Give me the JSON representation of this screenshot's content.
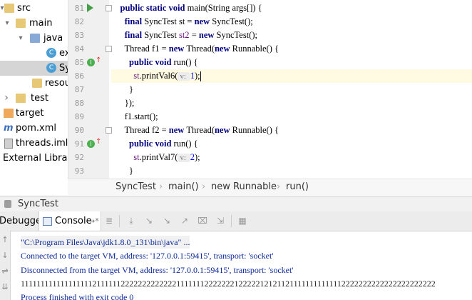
{
  "tree": {
    "items": [
      {
        "label": "src",
        "arrow": "▾",
        "icon": "folder"
      },
      {
        "label": "main",
        "arrow": "▾",
        "icon": "folder"
      },
      {
        "label": "java",
        "arrow": "▾",
        "icon": "folder-blue"
      },
      {
        "label": "ex",
        "arrow": "",
        "icon": "class"
      },
      {
        "label": "Sy",
        "arrow": "",
        "icon": "class"
      },
      {
        "label": "resou",
        "arrow": "",
        "icon": "folder"
      },
      {
        "label": "test",
        "arrow": "›",
        "icon": "folder"
      },
      {
        "label": "target",
        "arrow": "",
        "icon": "folder-orange"
      },
      {
        "label": "pom.xml",
        "arrow": "",
        "icon": "maven"
      },
      {
        "label": "threads.iml",
        "arrow": "",
        "icon": "iml"
      },
      {
        "label": "External Librarie",
        "arrow": "",
        "icon": "none"
      }
    ]
  },
  "editor": {
    "lines": [
      {
        "n": "81",
        "parts": [
          [
            "",
            "    "
          ],
          [
            "kw",
            "public static void "
          ],
          [
            "",
            "main(String args[]) {"
          ]
        ]
      },
      {
        "n": "82",
        "parts": [
          [
            "",
            "      "
          ],
          [
            "kw",
            "final "
          ],
          [
            "",
            "SyncTest st = "
          ],
          [
            "kw",
            "new "
          ],
          [
            "",
            "SyncTest();"
          ]
        ]
      },
      {
        "n": "83",
        "parts": [
          [
            "",
            "      "
          ],
          [
            "kw",
            "final "
          ],
          [
            "",
            "SyncTest "
          ],
          [
            "fld",
            "st2"
          ],
          [
            "",
            " = "
          ],
          [
            "kw",
            "new "
          ],
          [
            "",
            "SyncTest();"
          ]
        ]
      },
      {
        "n": "84",
        "parts": [
          [
            "",
            "      Thread f1 = "
          ],
          [
            "kw",
            "new "
          ],
          [
            "",
            "Thread("
          ],
          [
            "kw",
            "new "
          ],
          [
            "",
            "Runnable() {"
          ]
        ]
      },
      {
        "n": "85",
        "parts": [
          [
            "",
            "        "
          ],
          [
            "kw",
            "public void "
          ],
          [
            "",
            "run() {"
          ]
        ]
      },
      {
        "n": "86",
        "parts": [
          [
            "",
            "          "
          ],
          [
            "fld",
            "st"
          ],
          [
            "",
            ".printVal6("
          ],
          [
            "hint",
            "v: "
          ],
          [
            "num",
            "1"
          ],
          [
            "",
            ");"
          ]
        ]
      },
      {
        "n": "87",
        "parts": [
          [
            "",
            "        }"
          ]
        ]
      },
      {
        "n": "88",
        "parts": [
          [
            "",
            "      });"
          ]
        ]
      },
      {
        "n": "89",
        "parts": [
          [
            "",
            "      f1.start();"
          ]
        ]
      },
      {
        "n": "90",
        "parts": [
          [
            "",
            "      Thread f2 = "
          ],
          [
            "kw",
            "new "
          ],
          [
            "",
            "Thread("
          ],
          [
            "kw",
            "new "
          ],
          [
            "",
            "Runnable() {"
          ]
        ]
      },
      {
        "n": "91",
        "parts": [
          [
            "",
            "        "
          ],
          [
            "kw",
            "public void "
          ],
          [
            "",
            "run() {"
          ]
        ]
      },
      {
        "n": "92",
        "parts": [
          [
            "",
            "          "
          ],
          [
            "fld",
            "st"
          ],
          [
            "",
            ".printVal7("
          ],
          [
            "hint",
            "v: "
          ],
          [
            "num",
            "2"
          ],
          [
            "",
            ");"
          ]
        ]
      },
      {
        "n": "93",
        "parts": [
          [
            "",
            "        }"
          ]
        ]
      }
    ]
  },
  "breadcrumbs": [
    "SyncTest",
    "main()",
    "new Runnable",
    "run()"
  ],
  "run": {
    "title": "SyncTest",
    "tab_debugger": "Debugger",
    "tab_console": "Console",
    "tab_console_suffix": "→*",
    "output": [
      "\"C:\\Program Files\\Java\\jdk1.8.0_131\\bin\\java\" ...",
      "Connected to the target VM, address: '127.0.0.1:59415', transport: 'socket'",
      "Disconnected from the target VM, address: '127.0.0.1:59415', transport: 'socket'",
      "1111111111111111112111111222222222222211111112222222122222121211211111111111112222222222222222222222",
      "Process finished with exit code 0"
    ]
  },
  "colors": {
    "keyword": "#000080",
    "field": "#660e7a",
    "number": "#0000ff",
    "console_text": "#0b2a9c"
  }
}
